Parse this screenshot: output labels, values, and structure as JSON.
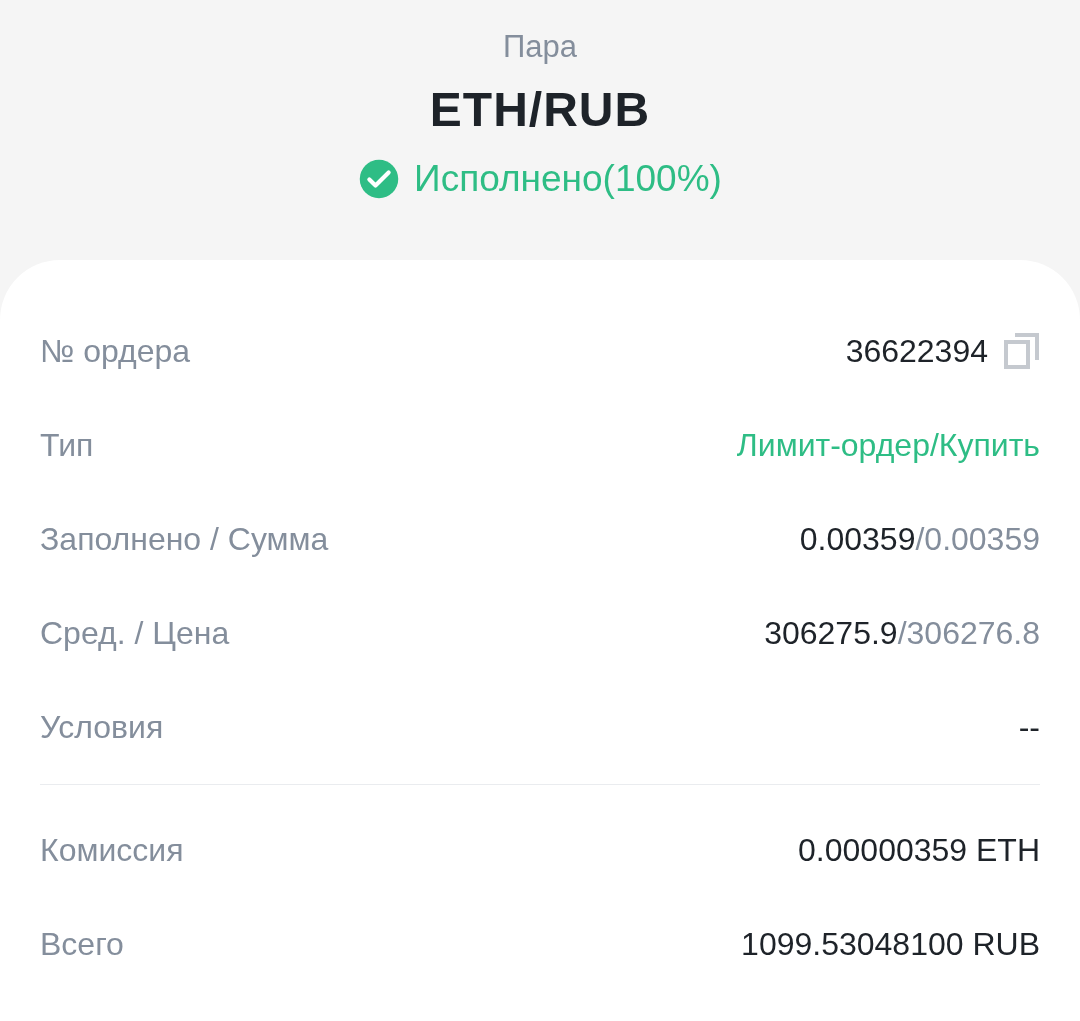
{
  "header": {
    "label": "Пара",
    "pair": "ETH/RUB",
    "status": {
      "text": "Исполнено(100%)",
      "kind": "filled"
    }
  },
  "sections": [
    {
      "rows": [
        {
          "label": "№ ордера",
          "copyable": true,
          "parts": [
            {
              "text": "36622394",
              "kind": "primary"
            }
          ]
        },
        {
          "label": "Тип",
          "copyable": false,
          "parts": [
            {
              "text": "Лимит-ордер/Купить",
              "kind": "accent"
            }
          ]
        },
        {
          "label": "Заполнено / Сумма",
          "copyable": false,
          "parts": [
            {
              "text": "0.00359",
              "kind": "primary"
            },
            {
              "text": "/0.00359",
              "kind": "muted"
            }
          ]
        },
        {
          "label": "Сред. / Цена",
          "copyable": false,
          "parts": [
            {
              "text": "306275.9",
              "kind": "primary"
            },
            {
              "text": "/306276.8",
              "kind": "muted"
            }
          ]
        },
        {
          "label": "Условия",
          "copyable": false,
          "parts": [
            {
              "text": "--",
              "kind": "primary"
            }
          ]
        }
      ]
    },
    {
      "rows": [
        {
          "label": "Комиссия",
          "copyable": false,
          "parts": [
            {
              "text": "0.00000359 ETH",
              "kind": "primary"
            }
          ]
        },
        {
          "label": "Всего",
          "copyable": false,
          "parts": [
            {
              "text": "1099.53048100 RUB",
              "kind": "primary"
            }
          ]
        }
      ]
    }
  ]
}
